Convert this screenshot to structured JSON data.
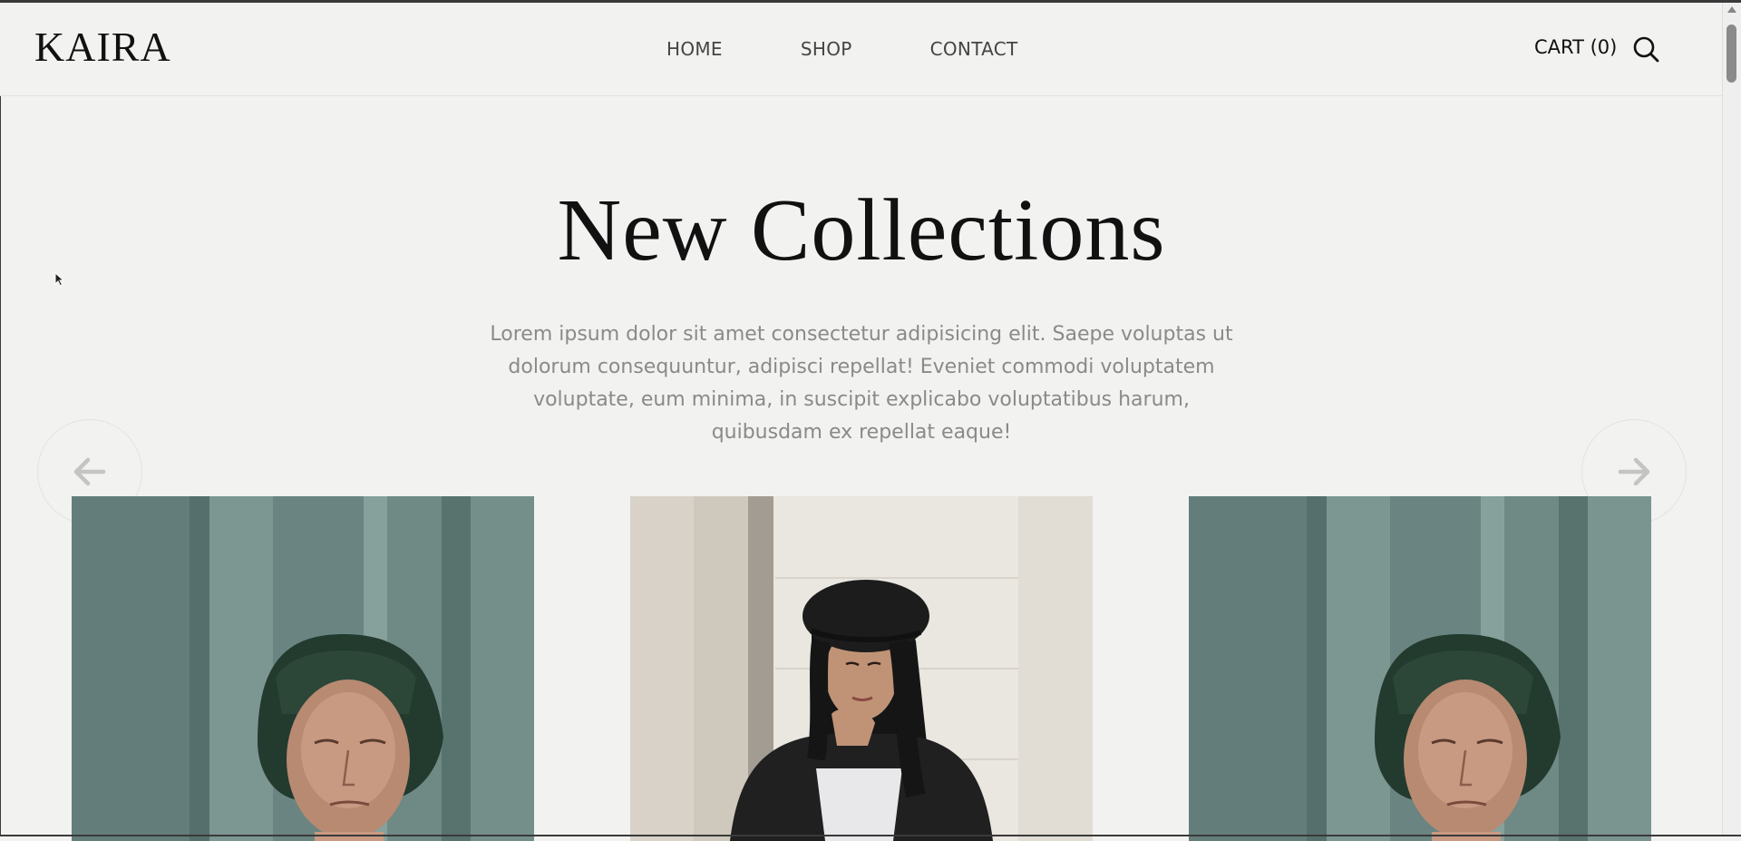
{
  "brand": {
    "logo": "KAIRA"
  },
  "nav": {
    "items": [
      {
        "label": "HOME"
      },
      {
        "label": "SHOP"
      },
      {
        "label": "CONTACT"
      }
    ]
  },
  "header_actions": {
    "cart_label": "CART (0)",
    "search_icon": "search-icon"
  },
  "hero": {
    "title": "New Collections",
    "description": "Lorem ipsum dolor sit amet consectetur adipisicing elit. Saepe voluptas ut dolorum consequuntur, adipisci repellat! Eveniet commodi voluptatem voluptate, eum minima, in suscipit explicabo voluptatibus harum, quibusdam ex repellat eaque!"
  },
  "carousel": {
    "prev_icon": "arrow-left-icon",
    "next_icon": "arrow-right-icon",
    "slides": [
      {
        "subject": "man in green bucket hat"
      },
      {
        "subject": "woman in black beret"
      },
      {
        "subject": "man in green bucket hat"
      }
    ]
  },
  "colors": {
    "background": "#f2f2f0",
    "text_dark": "#111111",
    "text_muted": "#8a8a8a"
  }
}
